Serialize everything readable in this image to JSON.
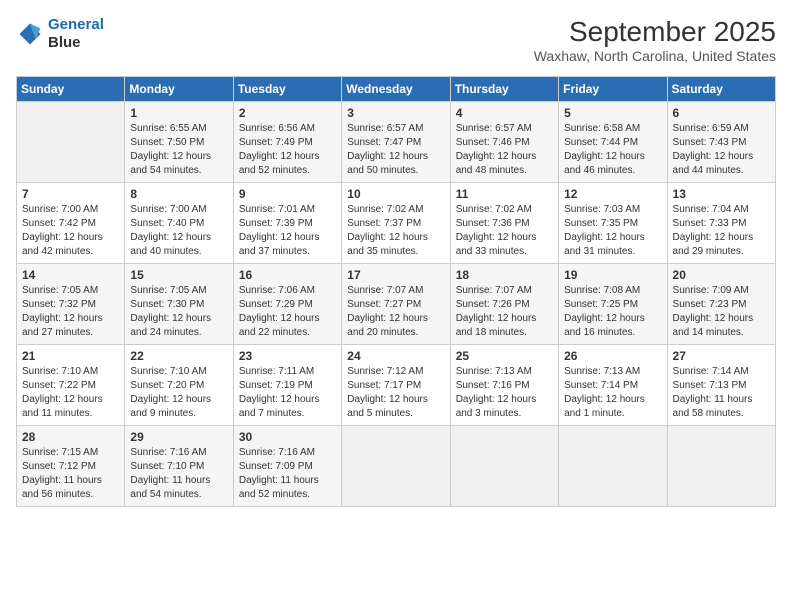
{
  "logo": {
    "line1": "General",
    "line2": "Blue"
  },
  "title": "September 2025",
  "location": "Waxhaw, North Carolina, United States",
  "days_header": [
    "Sunday",
    "Monday",
    "Tuesday",
    "Wednesday",
    "Thursday",
    "Friday",
    "Saturday"
  ],
  "weeks": [
    [
      {
        "day": "",
        "sunrise": "",
        "sunset": "",
        "daylight": ""
      },
      {
        "day": "1",
        "sunrise": "Sunrise: 6:55 AM",
        "sunset": "Sunset: 7:50 PM",
        "daylight": "Daylight: 12 hours and 54 minutes."
      },
      {
        "day": "2",
        "sunrise": "Sunrise: 6:56 AM",
        "sunset": "Sunset: 7:49 PM",
        "daylight": "Daylight: 12 hours and 52 minutes."
      },
      {
        "day": "3",
        "sunrise": "Sunrise: 6:57 AM",
        "sunset": "Sunset: 7:47 PM",
        "daylight": "Daylight: 12 hours and 50 minutes."
      },
      {
        "day": "4",
        "sunrise": "Sunrise: 6:57 AM",
        "sunset": "Sunset: 7:46 PM",
        "daylight": "Daylight: 12 hours and 48 minutes."
      },
      {
        "day": "5",
        "sunrise": "Sunrise: 6:58 AM",
        "sunset": "Sunset: 7:44 PM",
        "daylight": "Daylight: 12 hours and 46 minutes."
      },
      {
        "day": "6",
        "sunrise": "Sunrise: 6:59 AM",
        "sunset": "Sunset: 7:43 PM",
        "daylight": "Daylight: 12 hours and 44 minutes."
      }
    ],
    [
      {
        "day": "7",
        "sunrise": "Sunrise: 7:00 AM",
        "sunset": "Sunset: 7:42 PM",
        "daylight": "Daylight: 12 hours and 42 minutes."
      },
      {
        "day": "8",
        "sunrise": "Sunrise: 7:00 AM",
        "sunset": "Sunset: 7:40 PM",
        "daylight": "Daylight: 12 hours and 40 minutes."
      },
      {
        "day": "9",
        "sunrise": "Sunrise: 7:01 AM",
        "sunset": "Sunset: 7:39 PM",
        "daylight": "Daylight: 12 hours and 37 minutes."
      },
      {
        "day": "10",
        "sunrise": "Sunrise: 7:02 AM",
        "sunset": "Sunset: 7:37 PM",
        "daylight": "Daylight: 12 hours and 35 minutes."
      },
      {
        "day": "11",
        "sunrise": "Sunrise: 7:02 AM",
        "sunset": "Sunset: 7:36 PM",
        "daylight": "Daylight: 12 hours and 33 minutes."
      },
      {
        "day": "12",
        "sunrise": "Sunrise: 7:03 AM",
        "sunset": "Sunset: 7:35 PM",
        "daylight": "Daylight: 12 hours and 31 minutes."
      },
      {
        "day": "13",
        "sunrise": "Sunrise: 7:04 AM",
        "sunset": "Sunset: 7:33 PM",
        "daylight": "Daylight: 12 hours and 29 minutes."
      }
    ],
    [
      {
        "day": "14",
        "sunrise": "Sunrise: 7:05 AM",
        "sunset": "Sunset: 7:32 PM",
        "daylight": "Daylight: 12 hours and 27 minutes."
      },
      {
        "day": "15",
        "sunrise": "Sunrise: 7:05 AM",
        "sunset": "Sunset: 7:30 PM",
        "daylight": "Daylight: 12 hours and 24 minutes."
      },
      {
        "day": "16",
        "sunrise": "Sunrise: 7:06 AM",
        "sunset": "Sunset: 7:29 PM",
        "daylight": "Daylight: 12 hours and 22 minutes."
      },
      {
        "day": "17",
        "sunrise": "Sunrise: 7:07 AM",
        "sunset": "Sunset: 7:27 PM",
        "daylight": "Daylight: 12 hours and 20 minutes."
      },
      {
        "day": "18",
        "sunrise": "Sunrise: 7:07 AM",
        "sunset": "Sunset: 7:26 PM",
        "daylight": "Daylight: 12 hours and 18 minutes."
      },
      {
        "day": "19",
        "sunrise": "Sunrise: 7:08 AM",
        "sunset": "Sunset: 7:25 PM",
        "daylight": "Daylight: 12 hours and 16 minutes."
      },
      {
        "day": "20",
        "sunrise": "Sunrise: 7:09 AM",
        "sunset": "Sunset: 7:23 PM",
        "daylight": "Daylight: 12 hours and 14 minutes."
      }
    ],
    [
      {
        "day": "21",
        "sunrise": "Sunrise: 7:10 AM",
        "sunset": "Sunset: 7:22 PM",
        "daylight": "Daylight: 12 hours and 11 minutes."
      },
      {
        "day": "22",
        "sunrise": "Sunrise: 7:10 AM",
        "sunset": "Sunset: 7:20 PM",
        "daylight": "Daylight: 12 hours and 9 minutes."
      },
      {
        "day": "23",
        "sunrise": "Sunrise: 7:11 AM",
        "sunset": "Sunset: 7:19 PM",
        "daylight": "Daylight: 12 hours and 7 minutes."
      },
      {
        "day": "24",
        "sunrise": "Sunrise: 7:12 AM",
        "sunset": "Sunset: 7:17 PM",
        "daylight": "Daylight: 12 hours and 5 minutes."
      },
      {
        "day": "25",
        "sunrise": "Sunrise: 7:13 AM",
        "sunset": "Sunset: 7:16 PM",
        "daylight": "Daylight: 12 hours and 3 minutes."
      },
      {
        "day": "26",
        "sunrise": "Sunrise: 7:13 AM",
        "sunset": "Sunset: 7:14 PM",
        "daylight": "Daylight: 12 hours and 1 minute."
      },
      {
        "day": "27",
        "sunrise": "Sunrise: 7:14 AM",
        "sunset": "Sunset: 7:13 PM",
        "daylight": "Daylight: 11 hours and 58 minutes."
      }
    ],
    [
      {
        "day": "28",
        "sunrise": "Sunrise: 7:15 AM",
        "sunset": "Sunset: 7:12 PM",
        "daylight": "Daylight: 11 hours and 56 minutes."
      },
      {
        "day": "29",
        "sunrise": "Sunrise: 7:16 AM",
        "sunset": "Sunset: 7:10 PM",
        "daylight": "Daylight: 11 hours and 54 minutes."
      },
      {
        "day": "30",
        "sunrise": "Sunrise: 7:16 AM",
        "sunset": "Sunset: 7:09 PM",
        "daylight": "Daylight: 11 hours and 52 minutes."
      },
      {
        "day": "",
        "sunrise": "",
        "sunset": "",
        "daylight": ""
      },
      {
        "day": "",
        "sunrise": "",
        "sunset": "",
        "daylight": ""
      },
      {
        "day": "",
        "sunrise": "",
        "sunset": "",
        "daylight": ""
      },
      {
        "day": "",
        "sunrise": "",
        "sunset": "",
        "daylight": ""
      }
    ]
  ]
}
